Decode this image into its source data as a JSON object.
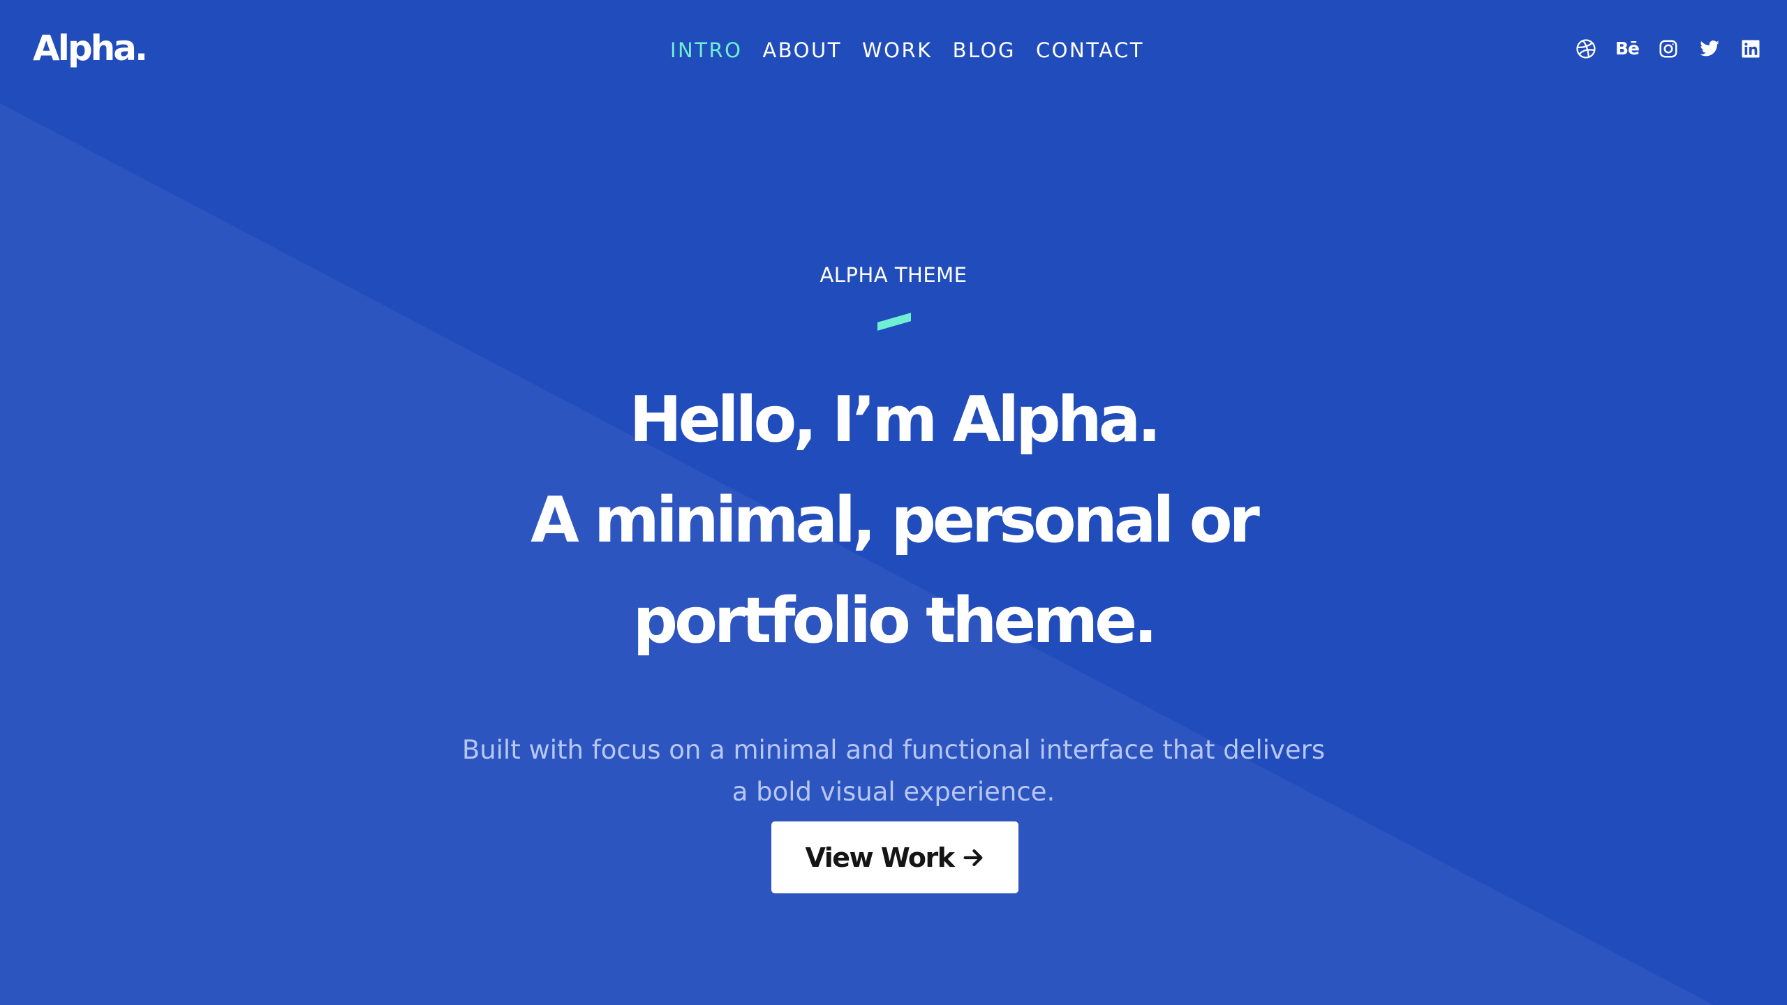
{
  "brand": {
    "logo": "Alpha."
  },
  "nav": {
    "items": [
      {
        "label": "INTRO",
        "active": true
      },
      {
        "label": "ABOUT",
        "active": false
      },
      {
        "label": "WORK",
        "active": false
      },
      {
        "label": "BLOG",
        "active": false
      },
      {
        "label": "CONTACT",
        "active": false
      }
    ]
  },
  "social": {
    "icons": [
      "dribbble-icon",
      "behance-icon",
      "instagram-icon",
      "twitter-icon",
      "linkedin-icon"
    ],
    "behance_label": "Bē"
  },
  "hero": {
    "eyebrow": "ALPHA THEME",
    "headline_line1": "Hello, I’m Alpha.",
    "headline_line2": "A minimal, personal or",
    "headline_line3": "portfolio theme.",
    "subtext_line1": "Built with focus on a minimal and functional interface that delivers",
    "subtext_line2": "a bold visual experience.",
    "cta_label": "View Work",
    "cta_icon": "arrow-right-icon"
  },
  "colors": {
    "background": "#204cbc",
    "background_light": "#2c55c0",
    "accent": "#6ff0d2",
    "subtext": "#b8c7f4",
    "button_bg": "#ffffff",
    "button_text": "#151515"
  }
}
